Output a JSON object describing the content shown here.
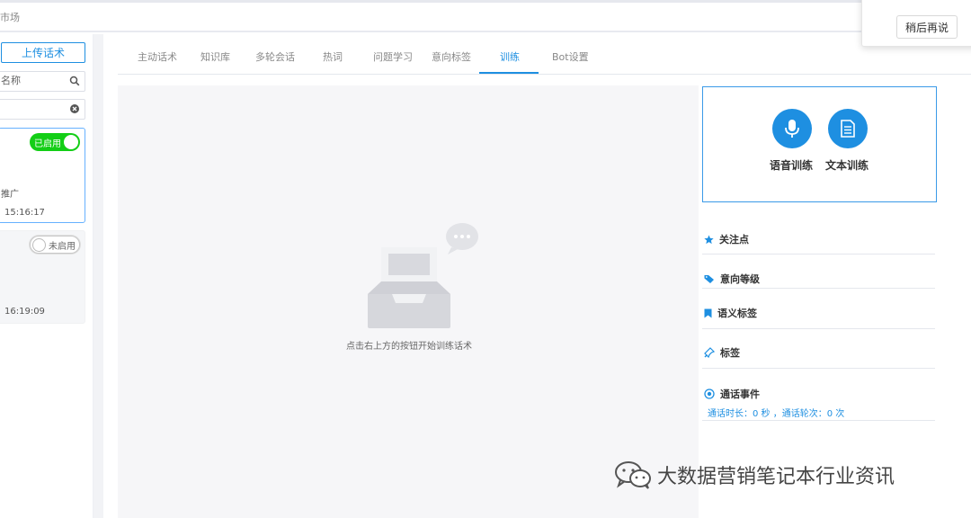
{
  "topbar": {
    "crumb": "市场"
  },
  "popup": {
    "later_label": "稍后再说"
  },
  "sidebar": {
    "upload_label": "上传话术",
    "search_name": {
      "value": "名称"
    },
    "search_second": {
      "value": ""
    },
    "cards": [
      {
        "status": "已启用",
        "frag1": "推广",
        "time": "15:16:17"
      },
      {
        "status": "未启用",
        "time": "16:19:09"
      }
    ]
  },
  "tabs": [
    {
      "label": "主动话术"
    },
    {
      "label": "知识库"
    },
    {
      "label": "多轮会话"
    },
    {
      "label": "热词"
    },
    {
      "label": "问题学习"
    },
    {
      "label": "意向标签"
    },
    {
      "label": "训练"
    },
    {
      "label": "Bot设置"
    }
  ],
  "active_tab": "训练",
  "empty": {
    "text": "点击右上方的按钮开始训练话术"
  },
  "training": {
    "voice_label": "语音训练",
    "text_label": "文本训练"
  },
  "sections": [
    {
      "title": "关注点",
      "icon": "star-icon"
    },
    {
      "title": "意向等级",
      "icon": "tags-icon"
    },
    {
      "title": "语义标签",
      "icon": "bookmark-icon"
    },
    {
      "title": "标签",
      "icon": "pin-icon"
    },
    {
      "title": "通话事件",
      "icon": "target-icon",
      "detail": "通话时长：0 秒 ，通话轮次：0 次"
    }
  ],
  "watermark": {
    "text": "大数据营销笔记本行业资讯"
  },
  "colors": {
    "accent": "#1e8fe1",
    "enabled": "#13ce16",
    "empty_bg": "#f6f6f8"
  }
}
